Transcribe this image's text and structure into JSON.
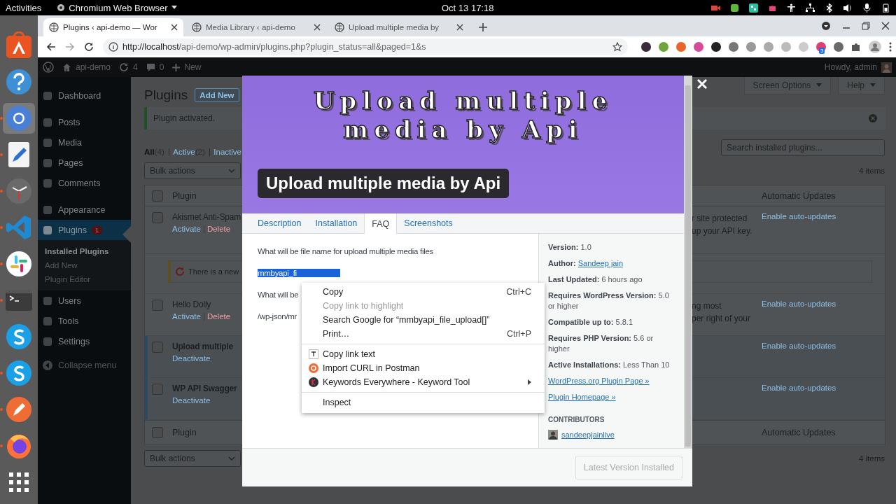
{
  "top_bar": {
    "activities": "Activities",
    "app_menu": "Chromium Web Browser",
    "clock": "Oct 13  17:18"
  },
  "dock": [
    {
      "kind": "software",
      "running": false,
      "selected": false
    },
    {
      "kind": "help",
      "running": false,
      "selected": false
    },
    {
      "kind": "browser",
      "running": true,
      "selected": true
    },
    {
      "kind": "editor",
      "running": true,
      "selected": false
    },
    {
      "kind": "clock",
      "running": true,
      "selected": false
    },
    {
      "kind": "code",
      "running": true,
      "selected": false
    },
    {
      "kind": "chat",
      "running": true,
      "selected": false
    },
    {
      "kind": "terminal",
      "running": true,
      "selected": false
    },
    {
      "kind": "call",
      "running": false,
      "selected": false
    },
    {
      "kind": "call",
      "running": true,
      "selected": false
    },
    {
      "kind": "api",
      "running": true,
      "selected": false
    },
    {
      "kind": "firefox",
      "running": true,
      "selected": false
    },
    {
      "kind": "grid",
      "running": false,
      "selected": false
    }
  ],
  "browser": {
    "tabs": [
      {
        "title": "Plugins ‹ api-demo — Wor",
        "selected": true
      },
      {
        "title": "Media Library ‹ api-demo",
        "selected": false
      },
      {
        "title": "Upload multiple media by",
        "selected": false
      }
    ],
    "url_host": "http://localhost",
    "url_path": "/api-demo/wp-admin/plugins.php?plugin_status=all&paged=1&s",
    "extension_badge": "3"
  },
  "admin_bar": {
    "site": "api-demo",
    "updates": "4",
    "comments": "0",
    "new": "New",
    "greeting": "Howdy, admin"
  },
  "sidebar": {
    "groups": [
      [
        {
          "label": "Dashboard",
          "selected": false
        }
      ],
      [
        {
          "label": "Posts",
          "selected": false
        },
        {
          "label": "Media",
          "selected": false
        },
        {
          "label": "Pages",
          "selected": false
        },
        {
          "label": "Comments",
          "selected": false
        }
      ],
      [
        {
          "label": "Appearance",
          "selected": false
        },
        {
          "label": "Plugins",
          "selected": true,
          "badge": "1",
          "children": [
            {
              "label": "Installed Plugins",
              "selected": true
            },
            {
              "label": "Add New",
              "selected": false
            },
            {
              "label": "Plugin Editor",
              "selected": false
            }
          ]
        },
        {
          "label": "Users",
          "selected": false
        },
        {
          "label": "Tools",
          "selected": false
        },
        {
          "label": "Settings",
          "selected": false
        }
      ]
    ],
    "collapse": "Collapse menu"
  },
  "page": {
    "title": "Plugins",
    "add_new": "Add New",
    "screen_options": "Screen Options",
    "help": "Help",
    "notice": "Plugin activated.",
    "filters": [
      {
        "label": "All",
        "count": "(4)",
        "selected": true
      },
      {
        "label": "Active",
        "count": "(2)",
        "selected": false
      },
      {
        "label": "Inactive",
        "selected": false
      }
    ],
    "bulk_action": "Bulk actions",
    "search_placeholder": "Search installed plugins...",
    "items_count": "4 items",
    "bottom_bulk_action": "Bulk actions",
    "bottom_items_count": "4 items"
  },
  "plugins_table": {
    "columns": [
      "Plugin",
      "Automatic Updates"
    ],
    "select_all_checked": false,
    "rows": [
      {
        "kind": "plugin",
        "name": "Akismet Anti-Spam",
        "active": false,
        "checked": false,
        "actions": [
          {
            "label": "Activate",
            "kind": "primary"
          },
          {
            "label": "Delete",
            "kind": "danger"
          }
        ],
        "description": [
          "r site protected",
          "up your API key."
        ],
        "auto_update": "Enable auto-updates"
      },
      {
        "kind": "notice",
        "text": "There is a new"
      },
      {
        "kind": "plugin",
        "name": "Hello Dolly",
        "active": false,
        "checked": false,
        "actions": [
          {
            "label": "Activate",
            "kind": "primary"
          },
          {
            "label": "Delete",
            "kind": "danger"
          }
        ],
        "description": [
          "ng most",
          "per right of your"
        ],
        "auto_update": "Enable auto-updates"
      },
      {
        "kind": "plugin",
        "name": "Upload multiple",
        "active": true,
        "checked": false,
        "actions": [
          {
            "label": "Deactivate",
            "kind": "primary"
          }
        ],
        "auto_update": "Enable auto-updates"
      },
      {
        "kind": "plugin",
        "name": "WP API Swagger",
        "active": true,
        "checked": false,
        "actions": [
          {
            "label": "Deactivate",
            "kind": "primary"
          }
        ],
        "auto_update": "Enable auto-updates"
      }
    ],
    "footer_columns": [
      "Plugin",
      "Automatic Updates"
    ]
  },
  "modal": {
    "banner_heading": [
      "Upload multiple",
      "media by Api"
    ],
    "title": "Upload multiple media by Api",
    "tabs": [
      {
        "label": "Description",
        "selected": false
      },
      {
        "label": "Installation",
        "selected": false
      },
      {
        "label": "FAQ",
        "selected": true
      },
      {
        "label": "Screenshots",
        "selected": false
      }
    ],
    "faq": [
      {
        "question": "What will be file name for upload multiple media files",
        "answer": "mmbyapi_fi",
        "answer_selected": true
      },
      {
        "question": "What will be",
        "answer": "/wp-json/mr",
        "answer_selected": false
      }
    ],
    "meta": [
      {
        "label": "Version:",
        "value": "1.0",
        "kind": "text"
      },
      {
        "label": "Author:",
        "value": "Sandeep jain",
        "kind": "link"
      },
      {
        "label": "Last Updated:",
        "value": "6 hours ago",
        "kind": "text"
      },
      {
        "label": "Requires WordPress Version:",
        "value": "5.0 or higher",
        "kind": "text"
      },
      {
        "label": "Compatible up to:",
        "value": "5.8.1",
        "kind": "text"
      },
      {
        "label": "Requires PHP Version:",
        "value": "5.6 or higher",
        "kind": "text"
      },
      {
        "label": "Active Installations:",
        "value": "Less Than 10",
        "kind": "text"
      }
    ],
    "links": [
      "WordPress.org Plugin Page »",
      "Plugin Homepage »"
    ],
    "contributors_heading": "CONTRIBUTORS",
    "contributors": [
      "sandeepjainlive"
    ],
    "install_button": {
      "label": "Latest Version Installed",
      "disabled": true
    }
  },
  "context_menu": {
    "groups": [
      [
        {
          "label": "Copy",
          "shortcut": "Ctrl+C",
          "disabled": false,
          "kind": "plain"
        },
        {
          "label": "Copy link to highlight",
          "disabled": true,
          "kind": "plain"
        },
        {
          "label": "Search Google for “mmbyapi_file_upload[]”",
          "disabled": false,
          "kind": "plain"
        },
        {
          "label": "Print…",
          "shortcut": "Ctrl+P",
          "disabled": false,
          "kind": "plain"
        }
      ],
      [
        {
          "label": "Copy link text",
          "disabled": false,
          "kind": "extension"
        },
        {
          "label": "Import CURL in Postman",
          "disabled": false,
          "kind": "extension"
        },
        {
          "label": "Keywords Everywhere - Keyword Tool",
          "disabled": false,
          "kind": "extension",
          "submenu": true
        }
      ],
      [
        {
          "label": "Inspect",
          "disabled": false,
          "kind": "plain"
        }
      ]
    ]
  }
}
